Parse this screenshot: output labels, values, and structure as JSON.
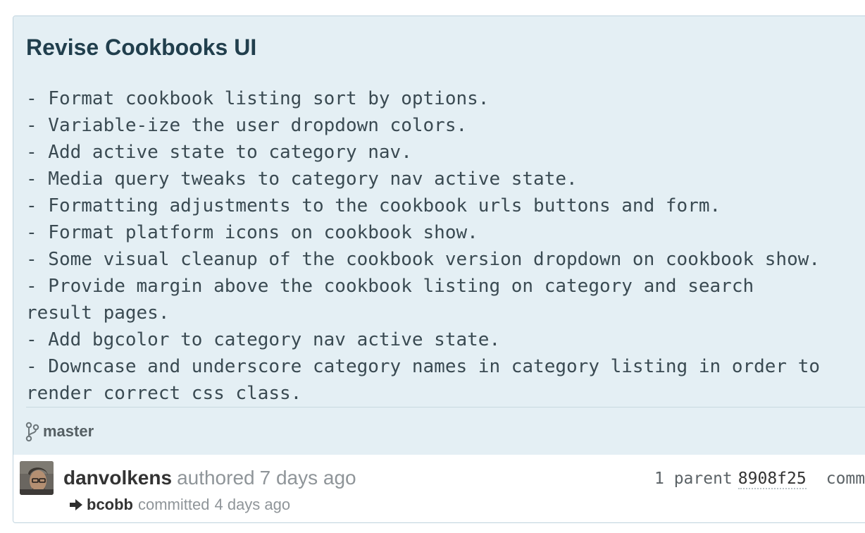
{
  "commit": {
    "title": "Revise Cookbooks UI",
    "description_lines": [
      "- Format cookbook listing sort by options.",
      "- Variable-ize the user dropdown colors.",
      "- Add active state to category nav.",
      "- Media query tweaks to category nav active state.",
      "- Formatting adjustments to the cookbook urls buttons and form.",
      "- Format platform icons on cookbook show.",
      "- Some visual cleanup of the cookbook version dropdown on cookbook show.",
      "- Provide margin above the cookbook listing on category and search",
      "  result pages.",
      "- Add bgcolor to category nav active state.",
      "- Downcase and underscore category names in category listing in order to",
      "  render correct css class."
    ],
    "branch": "master",
    "author": {
      "name": "danvolkens",
      "verb": "authored",
      "time": "7 days ago"
    },
    "committer": {
      "name": "bcobb",
      "verb": "committed",
      "time": "4 days ago"
    },
    "parent": {
      "label": "1 parent",
      "sha": "8908f25"
    },
    "commit_label": "comm"
  },
  "icons": {
    "branch": "branch-icon",
    "arrow": "arrow-right-icon",
    "avatar": "user-avatar"
  },
  "colors": {
    "panel_background": "#e4eff4",
    "title": "#213f4d",
    "muted_text": "#8f9599",
    "border": "#bfd3de"
  }
}
